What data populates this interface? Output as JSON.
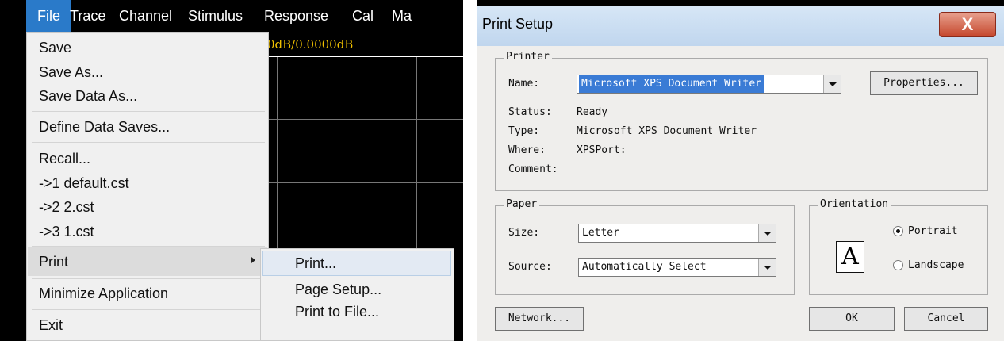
{
  "menubar": {
    "items": [
      "File",
      "Trace",
      "Channel",
      "Stimulus",
      "Response",
      "Cal",
      "Ma"
    ]
  },
  "trace": {
    "scale_text": "0dB/0.0000dB"
  },
  "file_menu": {
    "save": "Save",
    "save_as": "Save As...",
    "save_data_as": "Save Data As...",
    "define_data_saves": "Define Data Saves...",
    "recall": "Recall...",
    "recent_1": "->1 default.cst",
    "recent_2": "->2 2.cst",
    "recent_3": "->3 1.cst",
    "print": "Print",
    "minimize": "Minimize Application",
    "exit": "Exit"
  },
  "print_submenu": {
    "print": "Print...",
    "page_setup": "Page Setup...",
    "print_to_file": "Print to File..."
  },
  "print_setup": {
    "title": "Print Setup",
    "close_glyph": "X",
    "printer_group": "Printer",
    "name_label": "Name:",
    "name_value": "Microsoft XPS Document Writer",
    "properties_button": "Properties...",
    "status_label": "Status:",
    "status_value": "Ready",
    "type_label": "Type:",
    "type_value": "Microsoft XPS Document Writer",
    "where_label": "Where:",
    "where_value": "XPSPort:",
    "comment_label": "Comment:",
    "paper_group": "Paper",
    "size_label": "Size:",
    "size_value": "Letter",
    "source_label": "Source:",
    "source_value": "Automatically Select",
    "orientation_group": "Orientation",
    "orientation_icon_letter": "A",
    "portrait_label": "Portrait",
    "landscape_label": "Landscape",
    "selected_orientation": "Portrait",
    "network_button": "Network...",
    "ok_button": "OK",
    "cancel_button": "Cancel"
  }
}
